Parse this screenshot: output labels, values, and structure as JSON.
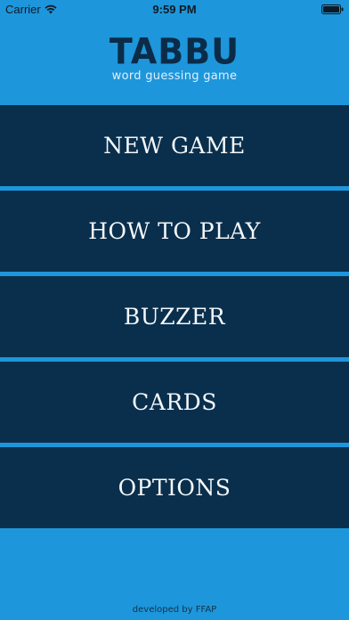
{
  "status_bar": {
    "carrier": "Carrier",
    "time": "9:59 PM"
  },
  "header": {
    "logo": "TABBU",
    "tagline": "word guessing game"
  },
  "menu": {
    "items": [
      {
        "label": "NEW GAME"
      },
      {
        "label": "HOW TO PLAY"
      },
      {
        "label": "BUZZER"
      },
      {
        "label": "CARDS"
      },
      {
        "label": "OPTIONS"
      }
    ]
  },
  "footer": {
    "text": "developed by FFAP"
  },
  "colors": {
    "background": "#1e96db",
    "menu_item": "#0a2f4c",
    "logo": "#0b2c48"
  },
  "icons": {
    "wifi": "wifi-icon",
    "battery": "battery-icon"
  }
}
